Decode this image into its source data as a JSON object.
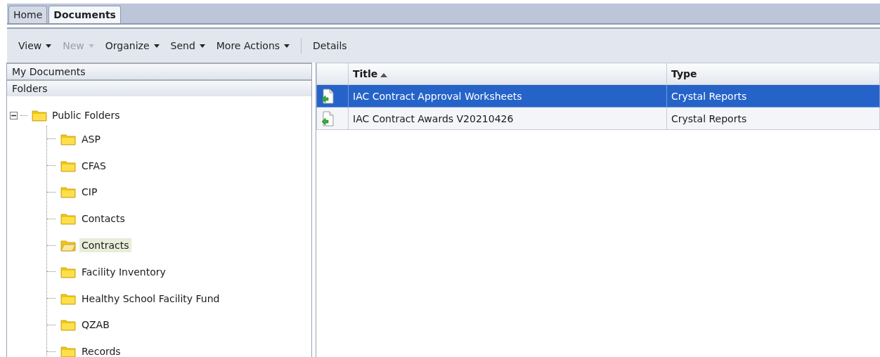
{
  "tabs": [
    {
      "label": "Home",
      "selected": false
    },
    {
      "label": "Documents",
      "selected": true
    }
  ],
  "toolbar": [
    {
      "label": "View",
      "kind": "menu",
      "disabled": false
    },
    {
      "label": "New",
      "kind": "menu",
      "disabled": true
    },
    {
      "label": "Organize",
      "kind": "menu",
      "disabled": false
    },
    {
      "label": "Send",
      "kind": "menu",
      "disabled": false
    },
    {
      "label": "More Actions",
      "kind": "menu",
      "disabled": false
    },
    {
      "label": "Details",
      "kind": "button",
      "disabled": false
    }
  ],
  "sidebar": {
    "sections": [
      {
        "label": "My Documents"
      },
      {
        "label": "Folders"
      }
    ],
    "tree": [
      {
        "label": "Public Folders",
        "expanded": true,
        "selected": false,
        "children": [
          {
            "label": "ASP",
            "selected": false
          },
          {
            "label": "CFAS",
            "selected": false
          },
          {
            "label": "CIP",
            "selected": false
          },
          {
            "label": "Contacts",
            "selected": false
          },
          {
            "label": "Contracts",
            "selected": true
          },
          {
            "label": "Facility Inventory",
            "selected": false
          },
          {
            "label": "Healthy School Facility Fund",
            "selected": false
          },
          {
            "label": "QZAB",
            "selected": false
          },
          {
            "label": "Records",
            "selected": false
          }
        ]
      }
    ]
  },
  "table": {
    "columns": [
      {
        "label": "Title",
        "sorted": true
      },
      {
        "label": "Type",
        "sorted": false
      }
    ],
    "rows": [
      {
        "title": "IAC Contract Approval Worksheets",
        "type": "Crystal Reports",
        "selected": true
      },
      {
        "title": "IAC Contract Awards V20210426",
        "type": "Crystal Reports",
        "selected": false
      }
    ]
  }
}
